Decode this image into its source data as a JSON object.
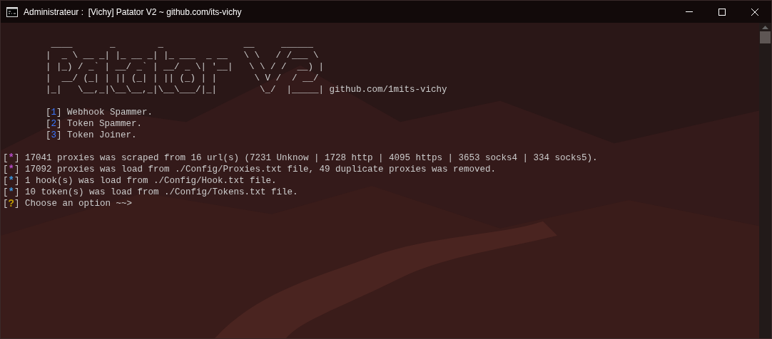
{
  "window": {
    "title": "Administrateur :  [Vichy] Patator V2 ~ github.com/its-vichy"
  },
  "banner": {
    "art": [
      "____       _        _               __     ______",
      "|  _ \\ __ _| |_ __ _| |_ ___  _ __   \\ \\   / /___ \\",
      "| |_) / _` | __/ _` | __/ _ \\| '__|   \\ \\ / /  __) |",
      "|  __/ (_| | || (_| | || (_) | |       \\ V /  / __/",
      "|_|   \\__,_|\\__\\__,_|\\__\\___/|_|        \\_/  |_____|"
    ],
    "link": "github.com/1mits-vichy"
  },
  "menu": [
    {
      "marker": [
        "[",
        "1",
        "]"
      ],
      "label": "Webhook Spammer."
    },
    {
      "marker": [
        "[",
        "2",
        "]"
      ],
      "label": "Token Spammer."
    },
    {
      "marker": [
        "[",
        "3",
        "]"
      ],
      "label": "Token Joiner."
    }
  ],
  "log": [
    {
      "marker": [
        "[",
        "*",
        "]"
      ],
      "color": "#b44cc4",
      "text": "17041 proxies was scraped from 16 url(s) (7231 Unknow | 1728 http | 4095 https | 3653 socks4 | 334 socks5)."
    },
    {
      "marker": [
        "[",
        "*",
        "]"
      ],
      "color": "#b44cc4",
      "text": "17092 proxies was load from ./Config/Proxies.txt file, 49 duplicate proxies was removed."
    },
    {
      "marker": [
        "[",
        "*",
        "]"
      ],
      "color": "#3a96dd",
      "text": "1 hook(s) was load from ./Config/Hook.txt file."
    },
    {
      "marker": [
        "[",
        "*",
        "]"
      ],
      "color": "#3a96dd",
      "text": "10 token(s) was load from ./Config/Tokens.txt file."
    },
    {
      "marker": [
        "[",
        "?",
        "]"
      ],
      "color": "#c19c00",
      "text": "Choose an option ~~>"
    }
  ]
}
